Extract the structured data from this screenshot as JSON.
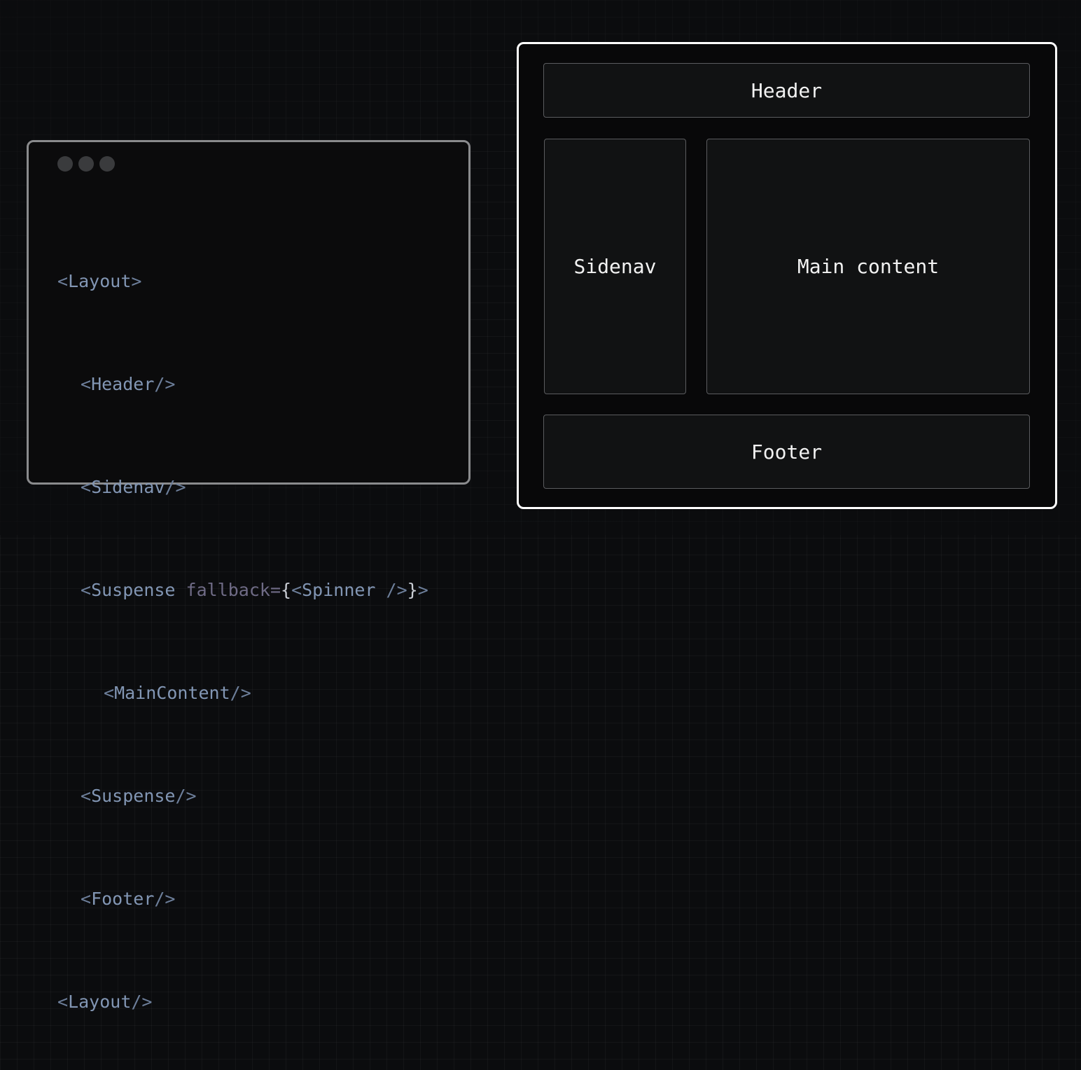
{
  "code_window": {
    "dots_icon": "window-controls-dots",
    "lines": [
      {
        "open": "<",
        "tag": "Layout",
        "close": ">"
      },
      {
        "open": "<",
        "tag": "Header",
        "close": "/>"
      },
      {
        "open": "<",
        "tag": "Sidenav",
        "close": "/>"
      },
      {
        "open": "<",
        "tag": "Suspense",
        "attr": " fallback=",
        "brace_open": "{",
        "inner_open": "<",
        "inner_tag": "Spinner",
        "inner_close": " />",
        "brace_close": "}",
        "close": ">"
      },
      {
        "open": "<",
        "tag": "MainContent",
        "close": "/>"
      },
      {
        "open": "<",
        "tag": "Suspense",
        "close": "/>"
      },
      {
        "open": "<",
        "tag": "Footer",
        "close": "/>"
      },
      {
        "open": "<",
        "tag": "Layout",
        "close": "/>"
      }
    ]
  },
  "layout_diagram": {
    "header": "Header",
    "sidenav": "Sidenav",
    "main": "Main content",
    "footer": "Footer"
  }
}
